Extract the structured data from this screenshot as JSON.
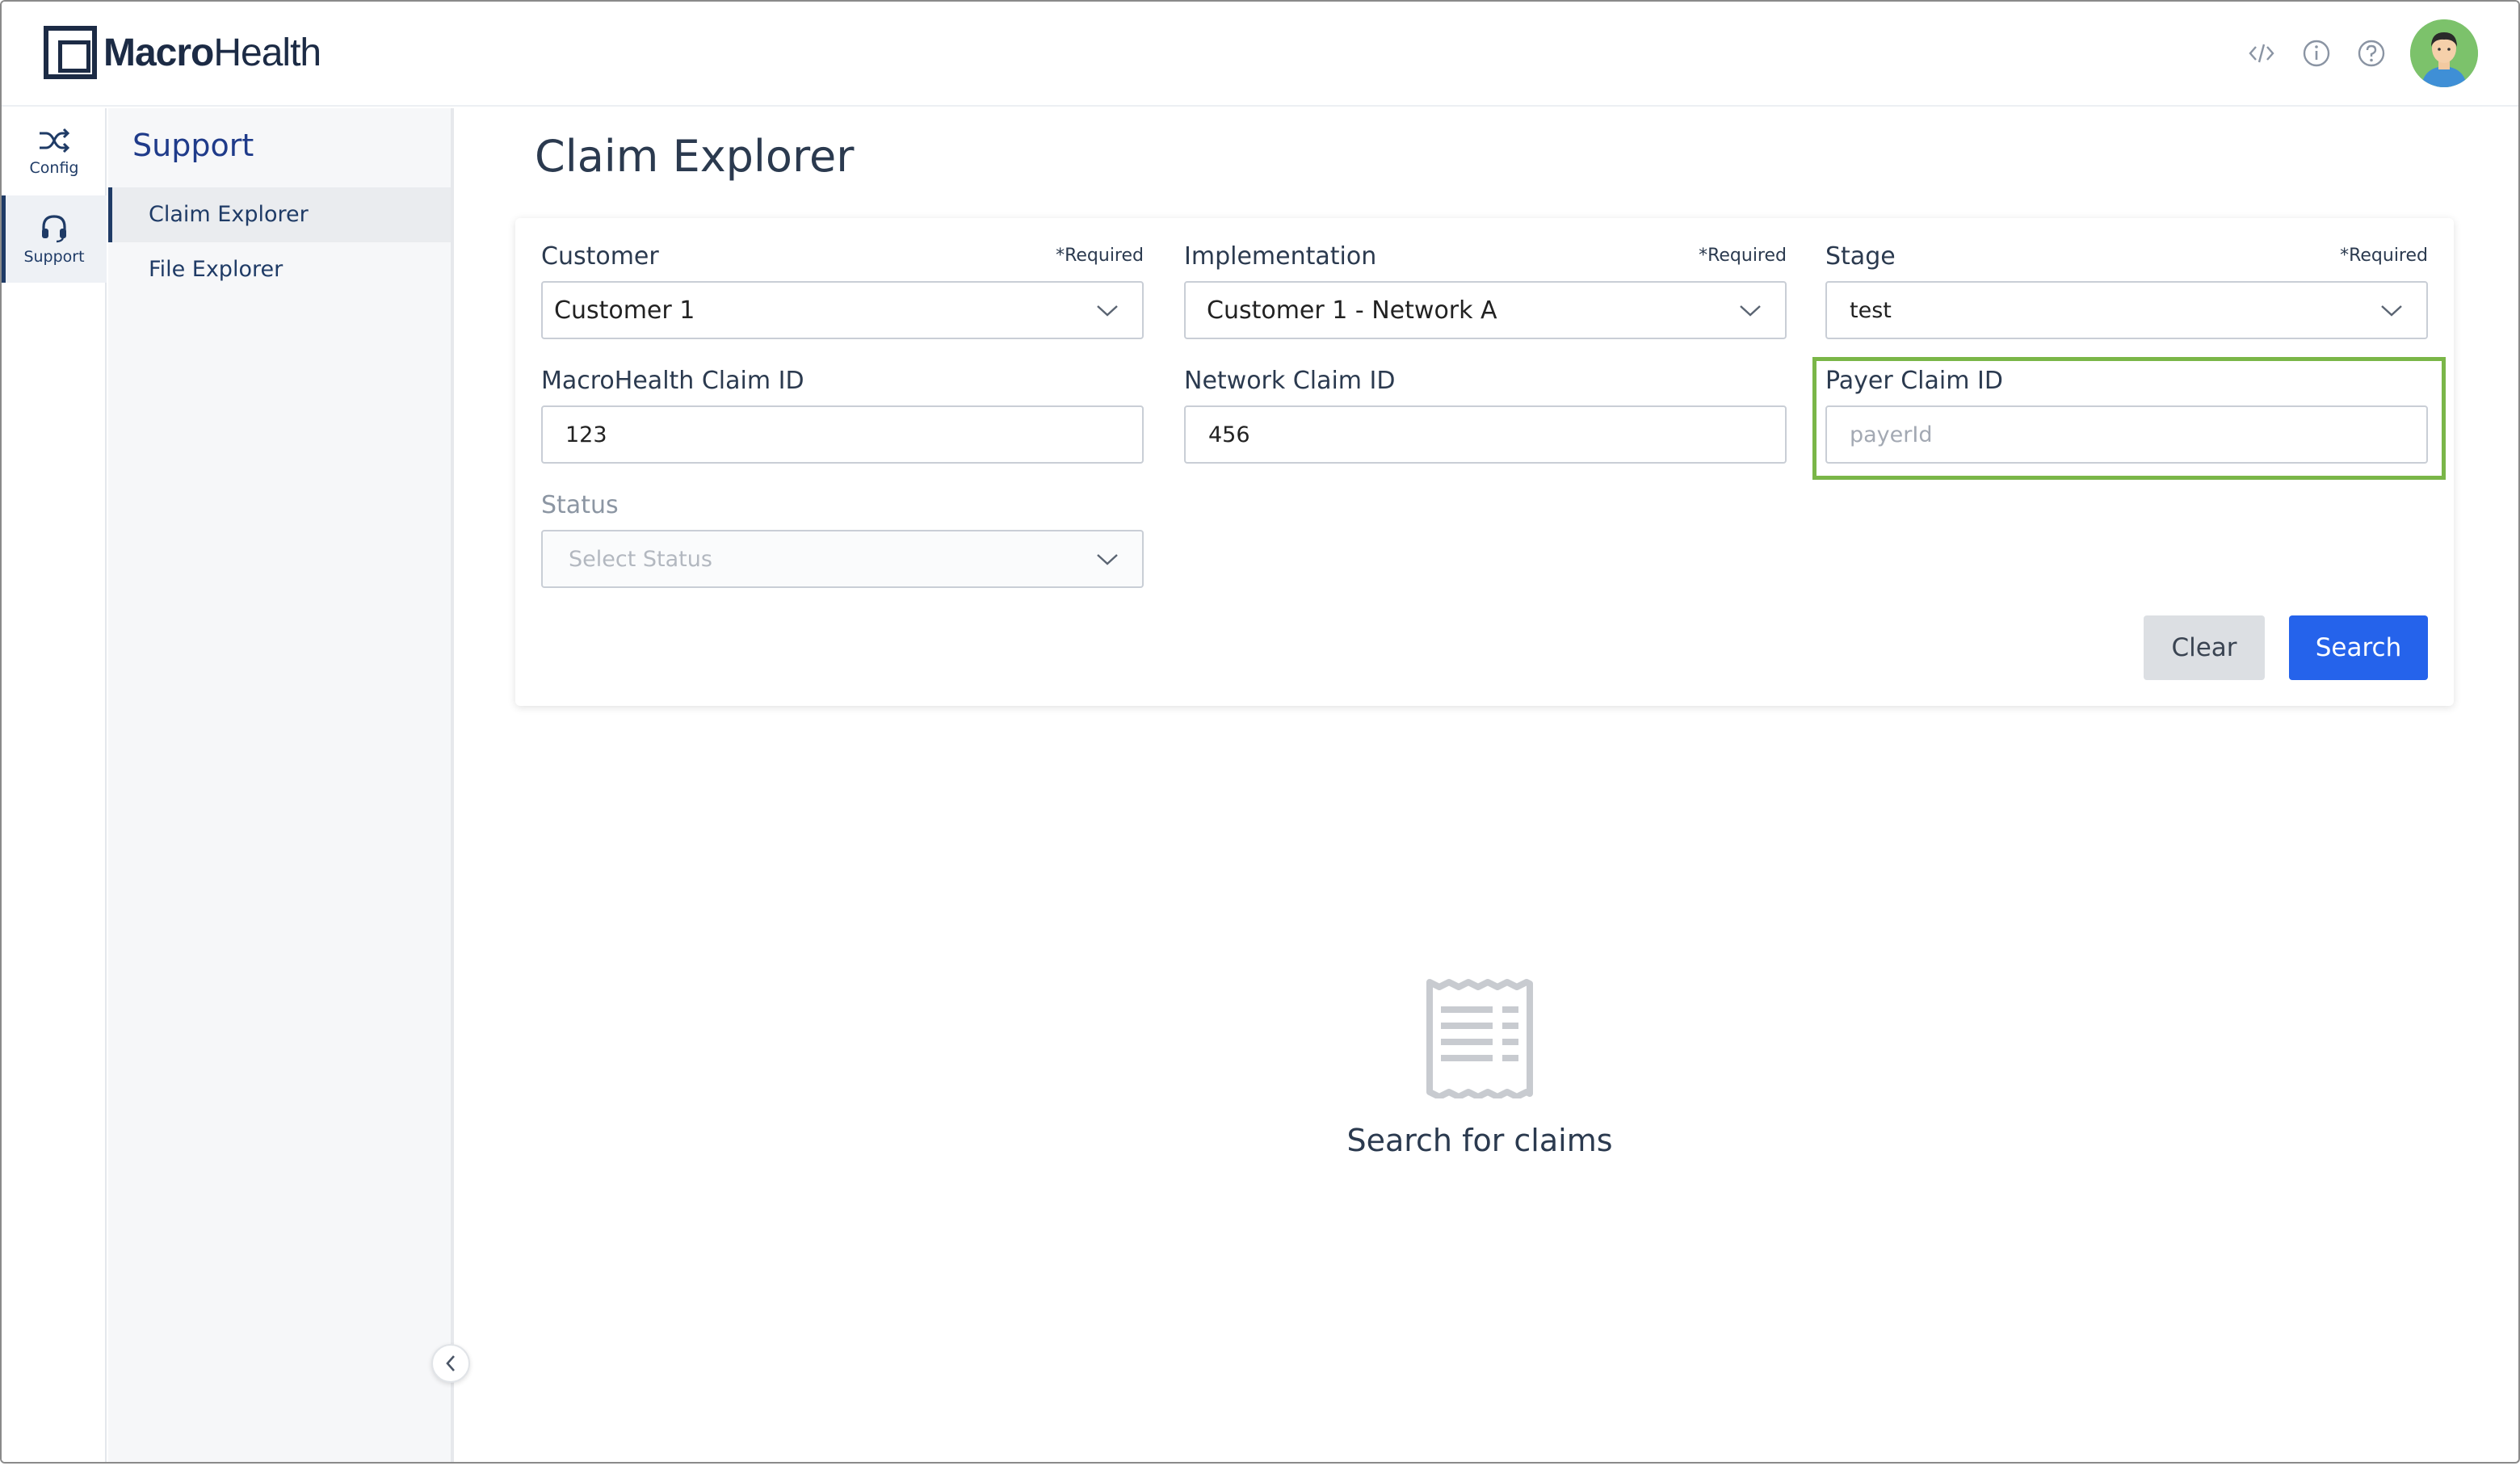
{
  "brand": {
    "bold": "Macro",
    "light": "Health"
  },
  "header": {
    "icons": [
      "code-icon",
      "info-icon",
      "help-icon"
    ]
  },
  "rail": {
    "items": [
      {
        "label": "Config",
        "icon": "shuffle-icon"
      },
      {
        "label": "Support",
        "icon": "headset-icon"
      }
    ]
  },
  "subnav": {
    "title": "Support",
    "items": [
      {
        "label": "Claim Explorer"
      },
      {
        "label": "File Explorer"
      }
    ]
  },
  "page": {
    "title": "Claim Explorer"
  },
  "form": {
    "customer": {
      "label": "Customer",
      "required": "*Required",
      "value": "Customer 1"
    },
    "implementation": {
      "label": "Implementation",
      "required": "*Required",
      "value": "Customer 1 - Network A"
    },
    "stage": {
      "label": "Stage",
      "required": "*Required",
      "value": "test"
    },
    "macro_claim_id": {
      "label": "MacroHealth Claim ID",
      "value": "123"
    },
    "network_claim_id": {
      "label": "Network Claim ID",
      "value": "456"
    },
    "payer_claim_id": {
      "label": "Payer Claim ID",
      "placeholder": "payerId"
    },
    "status": {
      "label": "Status",
      "placeholder": "Select Status"
    },
    "clear_label": "Clear",
    "search_label": "Search"
  },
  "empty_state": {
    "icon": "receipt-icon",
    "text": "Search for claims"
  },
  "colors": {
    "accent": "#2563eb",
    "highlight": "#7ab648",
    "navy": "#1f3b66"
  }
}
